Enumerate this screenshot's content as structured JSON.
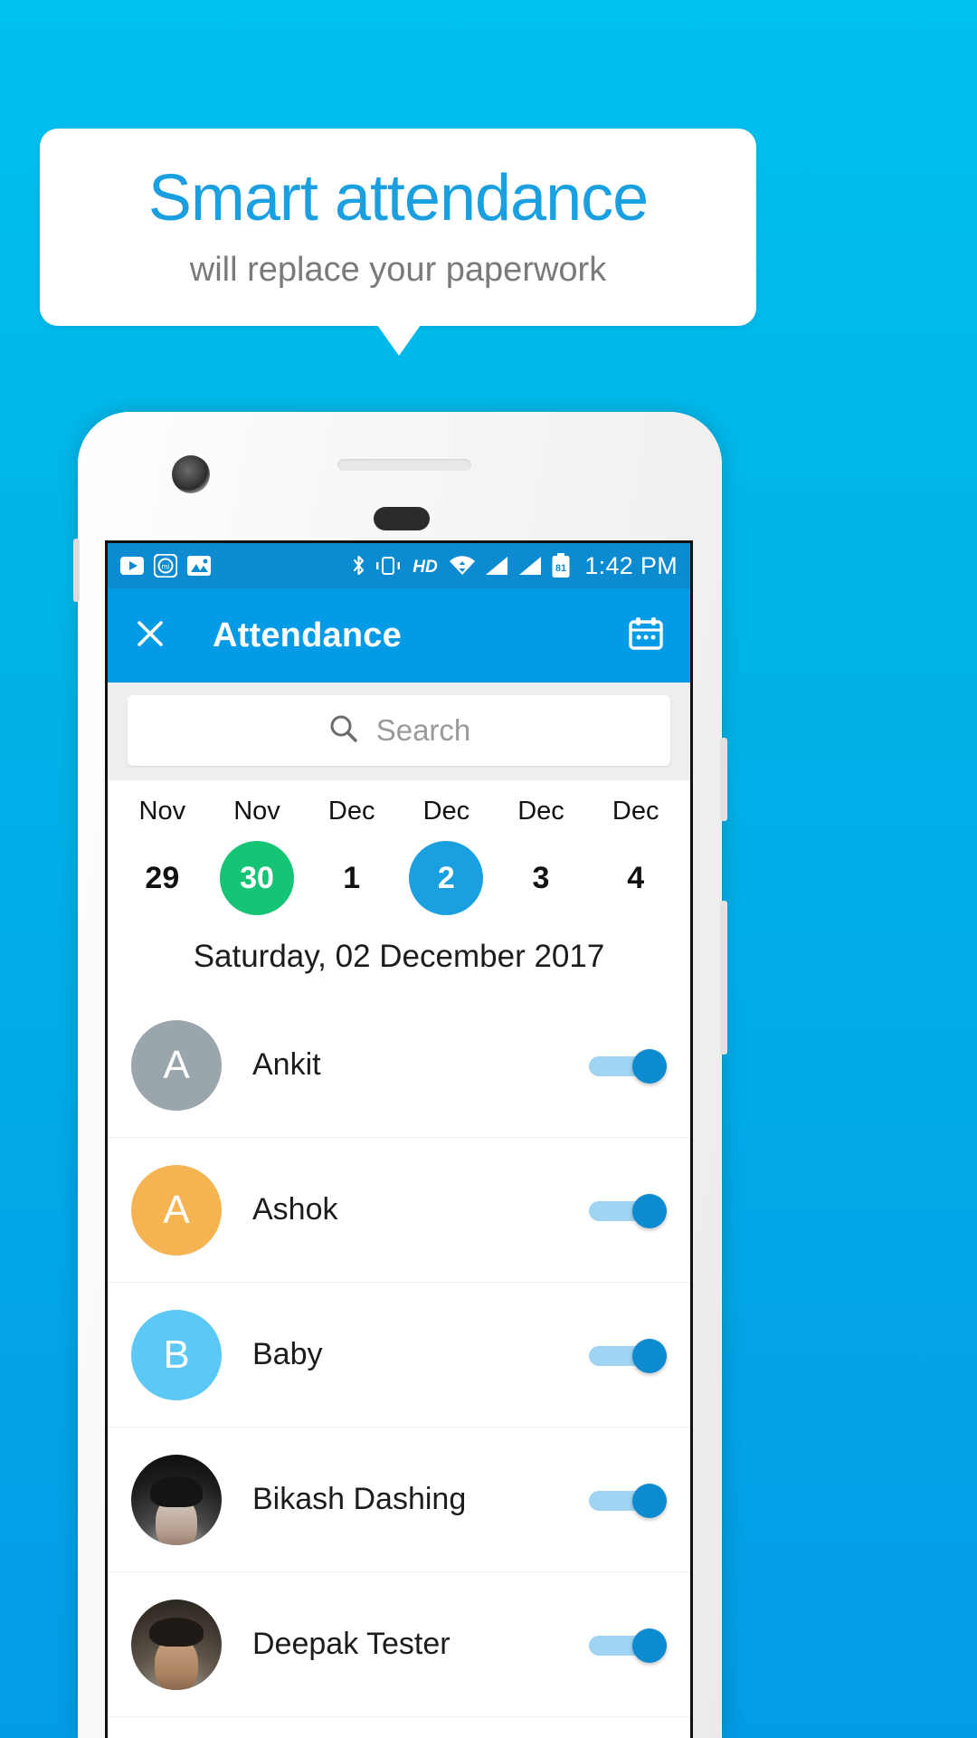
{
  "promo": {
    "title": "Smart attendance",
    "subtitle": "will replace your paperwork",
    "title_color": "#1a9fe0",
    "subtitle_color": "#7a7a7a",
    "background_color": "#00b4e8"
  },
  "statusbar": {
    "time": "1:42 PM",
    "battery_level": "81",
    "left_icons": [
      "youtube-icon",
      "mi-account-icon",
      "gallery-icon"
    ],
    "right_icons": [
      "bluetooth-icon",
      "vibrate-icon",
      "hd-icon",
      "wifi-icon",
      "signal-icon-1",
      "signal-icon-2",
      "battery-icon"
    ],
    "background_color": "#0d8bd0"
  },
  "appbar": {
    "close_label": "×",
    "title": "Attendance",
    "calendar_icon": "calendar-icon",
    "background_color": "#039be5"
  },
  "search": {
    "placeholder": "Search",
    "value": "",
    "icon": "search-icon"
  },
  "datestrip": {
    "days": [
      {
        "month": "Nov",
        "day": "29",
        "state": "normal"
      },
      {
        "month": "Nov",
        "day": "30",
        "state": "today"
      },
      {
        "month": "Dec",
        "day": "1",
        "state": "normal"
      },
      {
        "month": "Dec",
        "day": "2",
        "state": "selected"
      },
      {
        "month": "Dec",
        "day": "3",
        "state": "normal"
      },
      {
        "month": "Dec",
        "day": "4",
        "state": "normal"
      }
    ],
    "today_color": "#16c475",
    "selected_color": "#1a9fe0"
  },
  "selected_date_heading": "Saturday, 02 December 2017",
  "attendance_list": [
    {
      "name": "Ankit",
      "initial": "A",
      "avatar_type": "initial",
      "avatar_color": "#9aa6ab",
      "present": true
    },
    {
      "name": "Ashok",
      "initial": "A",
      "avatar_type": "initial",
      "avatar_color": "#f5b councils",
      "present": true
    },
    {
      "name": "Baby",
      "initial": "B",
      "avatar_type": "initial",
      "avatar_color": "#5bc8f5",
      "present": true
    },
    {
      "name": "Bikash Dashing",
      "initial": "",
      "avatar_type": "photo",
      "avatar_color": "#2a2a2a",
      "present": true
    },
    {
      "name": "Deepak Tester",
      "initial": "",
      "avatar_type": "photo",
      "avatar_color": "#6d5f4f",
      "present": true
    }
  ],
  "toggle": {
    "track_color": "#9fd4f2",
    "knob_color": "#0d8bd0"
  }
}
